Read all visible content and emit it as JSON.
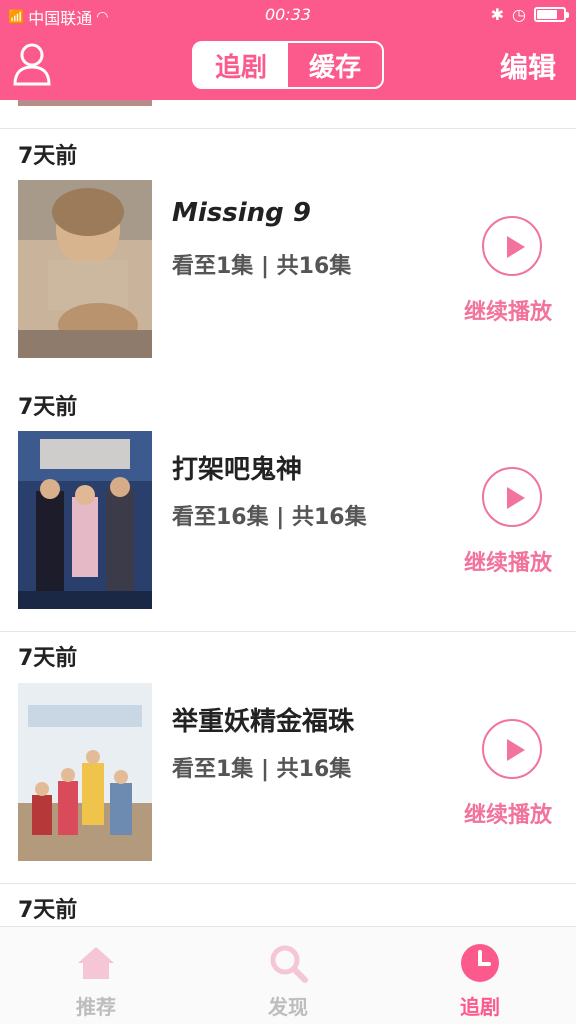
{
  "status_bar": {
    "carrier": "中国联通",
    "time": "00:33",
    "battery_percent": 80
  },
  "header": {
    "tabs": [
      {
        "label": "追剧",
        "active": true
      },
      {
        "label": "缓存",
        "active": false
      }
    ],
    "edit_label": "编辑"
  },
  "list": {
    "sections": [
      {
        "time_label": "7天前",
        "title": "Missing 9",
        "progress": "看至1集 | 共16集",
        "action": "继续播放"
      },
      {
        "time_label": "7天前",
        "title": "打架吧鬼神",
        "progress": "看至16集 | 共16集",
        "action": "继续播放"
      },
      {
        "time_label": "7天前",
        "title": "举重妖精金福珠",
        "progress": "看至1集 | 共16集",
        "action": "继续播放"
      },
      {
        "time_label": "7天前"
      }
    ]
  },
  "tabbar": {
    "items": [
      {
        "label": "推荐",
        "icon": "home-icon",
        "active": false
      },
      {
        "label": "发现",
        "icon": "search-icon",
        "active": false
      },
      {
        "label": "追剧",
        "icon": "clock-icon",
        "active": true
      }
    ]
  },
  "colors": {
    "brand_pink": "#fc5a8d",
    "accent_pink": "#f2739b",
    "inactive_gray": "#bdbdbd"
  }
}
